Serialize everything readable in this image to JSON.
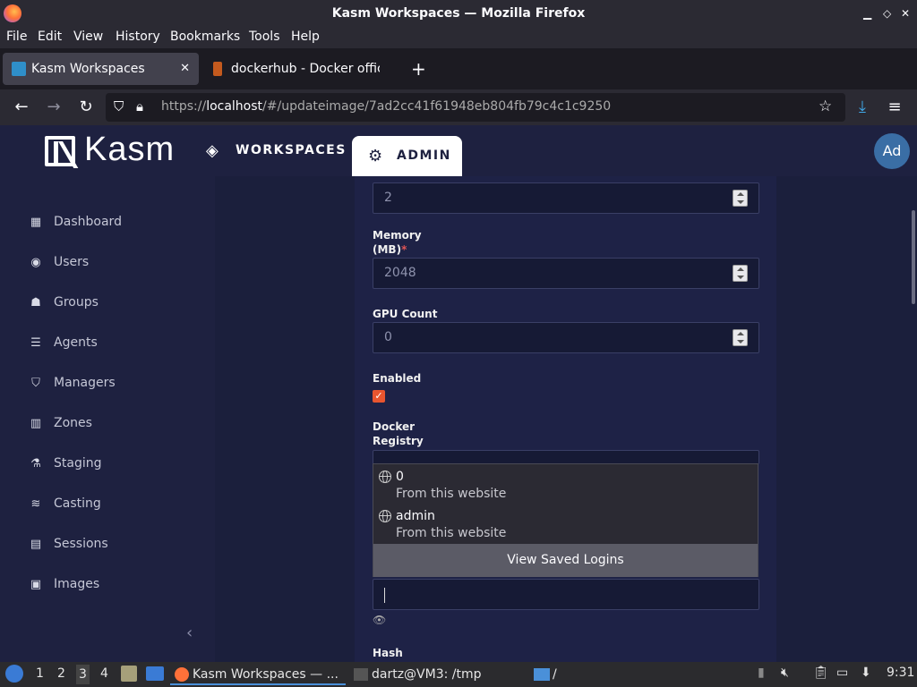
{
  "window": {
    "title": "Kasm Workspaces — Mozilla Firefox"
  },
  "menu": [
    "File",
    "Edit",
    "View",
    "History",
    "Bookmarks",
    "Tools",
    "Help"
  ],
  "tabs": [
    {
      "label": "Kasm Workspaces",
      "active": true
    },
    {
      "label": "dockerhub - Docker offici",
      "active": false
    }
  ],
  "url": {
    "prefix": "https://",
    "host": "localhost",
    "path": "/#/updateimage/7ad2cc41f61948eb804fb79c4c1c9250"
  },
  "kasm": {
    "logo": "Kasm",
    "nav": {
      "workspaces": "WORKSPACES",
      "admin": "ADMIN"
    },
    "avatar": "Ad"
  },
  "sidebar": [
    {
      "label": "Dashboard",
      "icon": "dashboard-icon"
    },
    {
      "label": "Users",
      "icon": "user-icon"
    },
    {
      "label": "Groups",
      "icon": "groups-icon"
    },
    {
      "label": "Agents",
      "icon": "agents-icon"
    },
    {
      "label": "Managers",
      "icon": "shield-icon"
    },
    {
      "label": "Zones",
      "icon": "map-icon"
    },
    {
      "label": "Staging",
      "icon": "flask-icon"
    },
    {
      "label": "Casting",
      "icon": "cast-icon"
    },
    {
      "label": "Sessions",
      "icon": "table-icon"
    },
    {
      "label": "Images",
      "icon": "image-icon"
    }
  ],
  "form": {
    "cores_value": "2",
    "memory_label_1": "Memory",
    "memory_label_2": "(MB)",
    "memory_required": "*",
    "memory_value": "2048",
    "gpu_label": "GPU Count",
    "gpu_value": "0",
    "enabled_label": "Enabled",
    "enabled_checked": true,
    "registry_label_1": "Docker",
    "registry_label_2": "Registry",
    "hash_label": "Hash"
  },
  "autocomplete": {
    "entries": [
      {
        "user": "0",
        "source": "From this website"
      },
      {
        "user": "admin",
        "source": "From this website"
      }
    ],
    "view_saved": "View Saved Logins"
  },
  "taskbar": {
    "workspaces": [
      "1",
      "2",
      "3",
      "4"
    ],
    "active_workspace": "3",
    "tasks": [
      {
        "label": "Kasm Workspaces — ...",
        "active": true
      },
      {
        "label": "dartz@VM3: /tmp",
        "active": false
      },
      {
        "label": "/",
        "active": false
      }
    ],
    "clock": "9:31"
  }
}
